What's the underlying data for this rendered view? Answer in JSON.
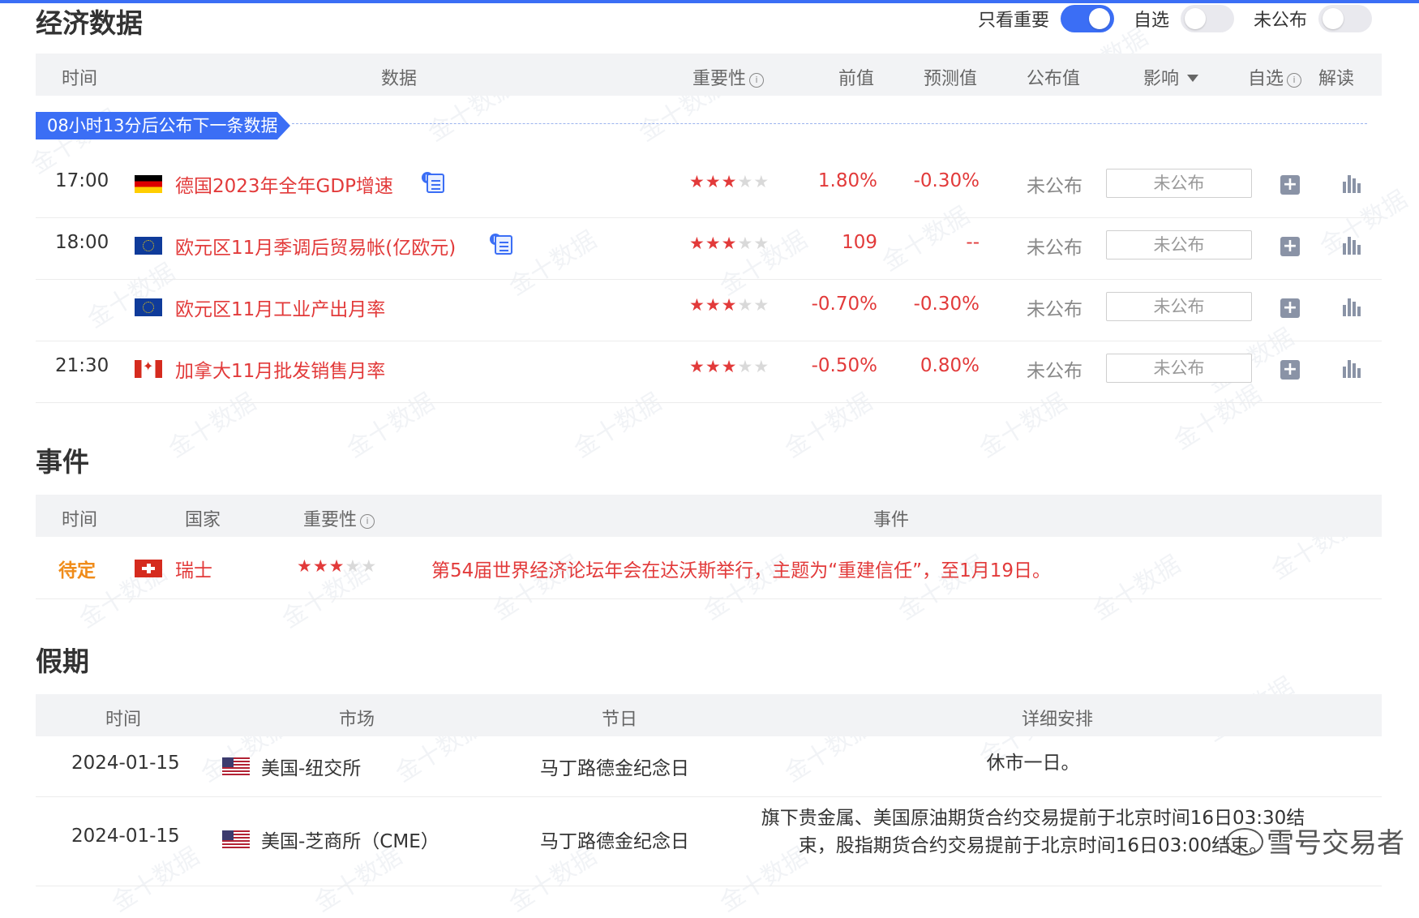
{
  "econ": {
    "title": "经济数据",
    "filters": [
      {
        "label": "只看重要",
        "on": true
      },
      {
        "label": "自选",
        "on": false
      },
      {
        "label": "未公布",
        "on": false
      }
    ],
    "headers": {
      "time": "时间",
      "data": "数据",
      "importance": "重要性",
      "prev": "前值",
      "forecast": "预测值",
      "actual": "公布值",
      "impact": "影响",
      "watch": "自选",
      "interpret": "解读"
    },
    "next_banner": "08小时13分后公布下一条数据",
    "rows": [
      {
        "time": "17:00",
        "flag": "de",
        "name": "德国2023年全年GDP增速",
        "has_doc": true,
        "stars": 3,
        "prev": "1.80%",
        "forecast": "-0.30%",
        "actual": "未公布",
        "impact": "未公布"
      },
      {
        "time": "18:00",
        "flag": "eu",
        "name": "欧元区11月季调后贸易帐(亿欧元)",
        "has_doc": true,
        "stars": 3,
        "prev": "109",
        "forecast": "--",
        "actual": "未公布",
        "impact": "未公布"
      },
      {
        "time": "",
        "flag": "eu",
        "name": "欧元区11月工业产出月率",
        "has_doc": false,
        "stars": 3,
        "prev": "-0.70%",
        "forecast": "-0.30%",
        "actual": "未公布",
        "impact": "未公布"
      },
      {
        "time": "21:30",
        "flag": "ca",
        "name": "加拿大11月批发销售月率",
        "has_doc": false,
        "stars": 3,
        "prev": "-0.50%",
        "forecast": "0.80%",
        "actual": "未公布",
        "impact": "未公布"
      }
    ]
  },
  "events": {
    "title": "事件",
    "headers": {
      "time": "时间",
      "country": "国家",
      "importance": "重要性",
      "event": "事件"
    },
    "rows": [
      {
        "time": "待定",
        "flag": "ch",
        "country": "瑞士",
        "stars": 3,
        "event": "第54届世界经济论坛年会在达沃斯举行，主题为“重建信任”，至1月19日。"
      }
    ]
  },
  "holidays": {
    "title": "假期",
    "headers": {
      "time": "时间",
      "market": "市场",
      "holiday": "节日",
      "detail": "详细安排"
    },
    "rows": [
      {
        "date": "2024-01-15",
        "flag": "us",
        "market": "美国-纽交所",
        "holiday": "马丁路德金纪念日",
        "detail_1": "休市一日。",
        "detail_2": ""
      },
      {
        "date": "2024-01-15",
        "flag": "us",
        "market": "美国-芝商所（CME）",
        "holiday": "马丁路德金纪念日",
        "detail_1": "旗下贵金属、美国原油期货合约交易提前于北京时间16日03:30结",
        "detail_2": "束，股指期货合约交易提前于北京时间16日03:00结束。"
      }
    ]
  },
  "watermark": "金十数据",
  "signature": "雪号交易者",
  "colors": {
    "accent": "#3b6ef5",
    "red": "#e23a3a",
    "orange": "#f08c1a"
  }
}
